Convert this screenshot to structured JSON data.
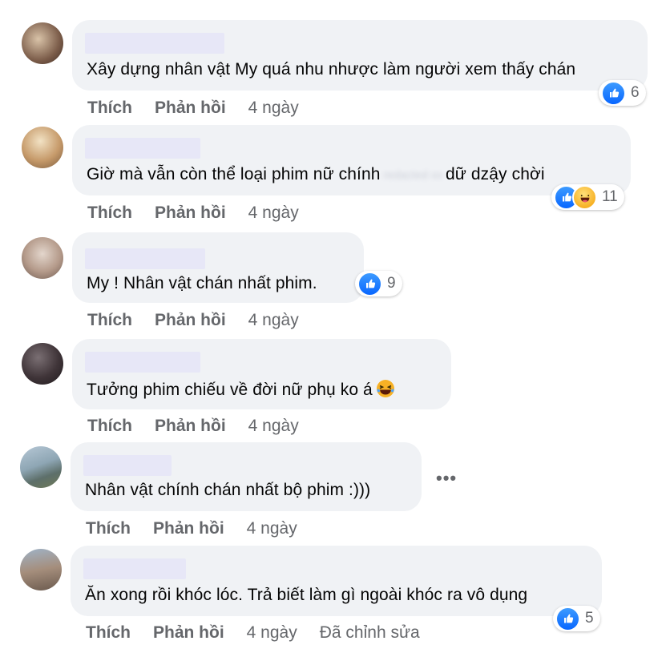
{
  "comments": [
    {
      "text": "Xây dựng nhân vật My quá nhu nhược làm người xem thấy chán",
      "reactions": {
        "types": [
          "like-icon"
        ],
        "count": "6"
      },
      "actions": {
        "like": "Thích",
        "reply": "Phản hồi",
        "time": "4 ngày"
      }
    },
    {
      "text_before": "Giờ mà vẫn còn thể loại phim nữ chính",
      "text_after": "dữ dzậy chời",
      "reactions": {
        "types": [
          "like-icon",
          "haha-icon"
        ],
        "count": "11"
      },
      "actions": {
        "like": "Thích",
        "reply": "Phản hồi",
        "time": "4 ngày"
      }
    },
    {
      "text": "My ! Nhân vật chán nhất phim.",
      "reactions": {
        "types": [
          "like-icon"
        ],
        "count": "9"
      },
      "actions": {
        "like": "Thích",
        "reply": "Phản hồi",
        "time": "4 ngày"
      }
    },
    {
      "text": "Tưởng phim chiếu về đời nữ phụ ko á",
      "emoji": "laughing-tears-icon",
      "actions": {
        "like": "Thích",
        "reply": "Phản hồi",
        "time": "4 ngày"
      }
    },
    {
      "text": "Nhân vật chính chán nhất bộ phim :)))",
      "more": "•••",
      "actions": {
        "like": "Thích",
        "reply": "Phản hồi",
        "time": "4 ngày"
      }
    },
    {
      "text": "Ăn xong rồi khóc lóc. Trả biết làm gì ngoài khóc ra vô dụng",
      "reactions": {
        "types": [
          "like-icon"
        ],
        "count": "5"
      },
      "actions": {
        "like": "Thích",
        "reply": "Phản hồi",
        "time": "4 ngày",
        "edited": "Đã chỉnh sửa"
      }
    }
  ],
  "colors": {
    "bubble": "#f0f2f5",
    "name_redaction": "#e7e7f7",
    "secondary_text": "#65676b",
    "like_blue": "#0866ff"
  }
}
